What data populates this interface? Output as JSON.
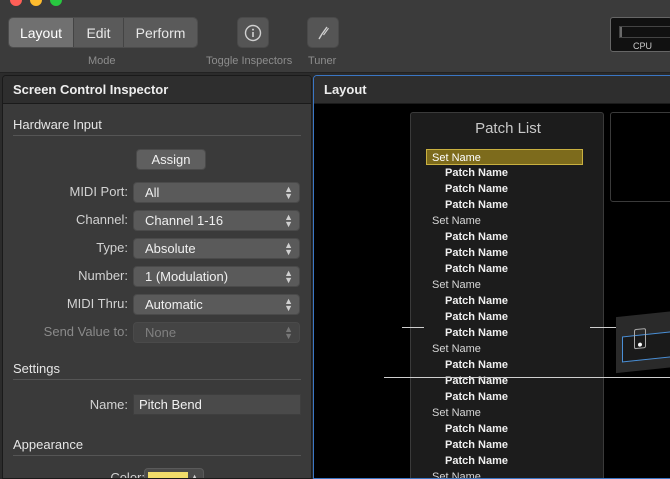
{
  "toolbar": {
    "mode_buttons": [
      {
        "label": "Layout",
        "active": true
      },
      {
        "label": "Edit",
        "active": false
      },
      {
        "label": "Perform",
        "active": false
      }
    ],
    "mode_label": "Mode",
    "toggle_inspectors_label": "Toggle Inspectors",
    "tuner_label": "Tuner",
    "cpu_label": "CPU"
  },
  "inspector": {
    "title": "Screen Control Inspector",
    "hardware_input": {
      "heading": "Hardware Input",
      "assign_label": "Assign",
      "fields": [
        {
          "label": "MIDI Port:",
          "value": "All",
          "disabled": false
        },
        {
          "label": "Channel:",
          "value": "Channel 1-16",
          "disabled": false
        },
        {
          "label": "Type:",
          "value": "Absolute",
          "disabled": false
        },
        {
          "label": "Number:",
          "value": "1 (Modulation)",
          "disabled": false
        },
        {
          "label": "MIDI Thru:",
          "value": "Automatic",
          "disabled": false
        },
        {
          "label": "Send Value to:",
          "value": "None",
          "disabled": true
        }
      ]
    },
    "settings": {
      "heading": "Settings",
      "name_label": "Name:",
      "name_value": "Pitch Bend"
    },
    "appearance": {
      "heading": "Appearance",
      "color_label": "Color:",
      "color_value": "#f1dc6a"
    }
  },
  "layout_panel": {
    "title": "Layout",
    "patch_list": {
      "title": "Patch List",
      "items": [
        {
          "text": "Set Name",
          "kind": "set",
          "selected": true
        },
        {
          "text": "Patch Name",
          "kind": "patch"
        },
        {
          "text": "Patch Name",
          "kind": "patch"
        },
        {
          "text": "Patch Name",
          "kind": "patch"
        },
        {
          "text": "Set Name",
          "kind": "set"
        },
        {
          "text": "Patch Name",
          "kind": "patch"
        },
        {
          "text": "Patch Name",
          "kind": "patch"
        },
        {
          "text": "Patch Name",
          "kind": "patch"
        },
        {
          "text": "Set Name",
          "kind": "set"
        },
        {
          "text": "Patch Name",
          "kind": "patch"
        },
        {
          "text": "Patch Name",
          "kind": "patch"
        },
        {
          "text": "Patch Name",
          "kind": "patch"
        },
        {
          "text": "Set Name",
          "kind": "set"
        },
        {
          "text": "Patch Name",
          "kind": "patch"
        },
        {
          "text": "Patch Name",
          "kind": "patch"
        },
        {
          "text": "Patch Name",
          "kind": "patch"
        },
        {
          "text": "Set Name",
          "kind": "set"
        },
        {
          "text": "Patch Name",
          "kind": "patch"
        },
        {
          "text": "Patch Name",
          "kind": "patch"
        },
        {
          "text": "Patch Name",
          "kind": "patch"
        },
        {
          "text": "Set Name",
          "kind": "set"
        }
      ]
    }
  }
}
